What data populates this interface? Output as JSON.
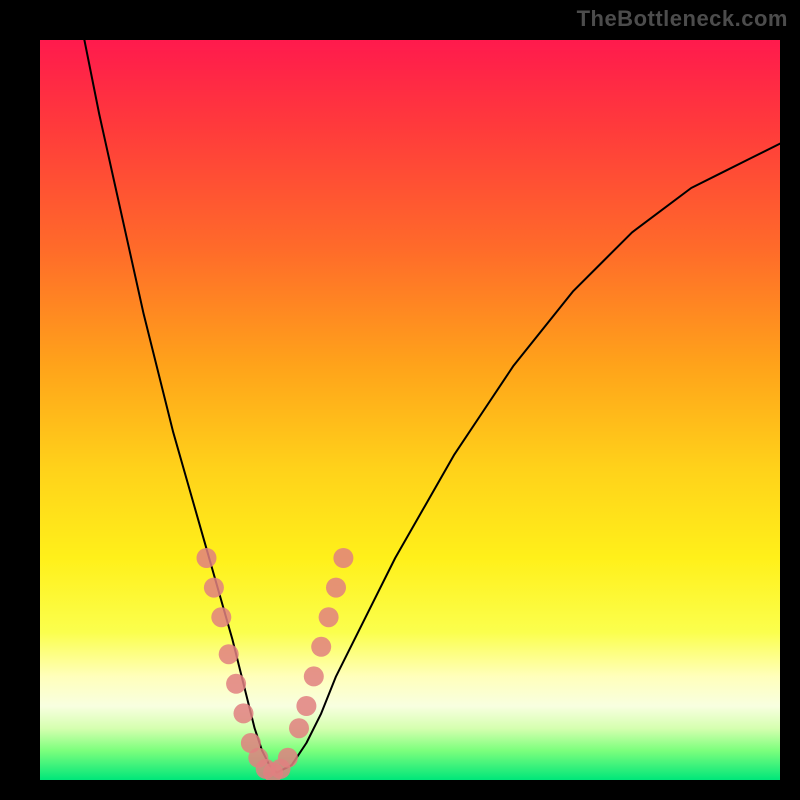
{
  "watermark": "TheBottleneck.com",
  "chart_data": {
    "type": "line",
    "title": "",
    "xlabel": "",
    "ylabel": "",
    "xlim": [
      0,
      100
    ],
    "ylim": [
      0,
      100
    ],
    "series": [
      {
        "name": "bottleneck-curve",
        "x": [
          6,
          8,
          10,
          12,
          14,
          16,
          18,
          20,
          22,
          24,
          26,
          27,
          28,
          29,
          30,
          31,
          32,
          34,
          36,
          38,
          40,
          44,
          48,
          52,
          56,
          60,
          64,
          68,
          72,
          76,
          80,
          84,
          88,
          92,
          96,
          100
        ],
        "y": [
          100,
          90,
          81,
          72,
          63,
          55,
          47,
          40,
          33,
          26,
          19,
          15,
          11,
          7,
          4,
          2,
          1,
          2,
          5,
          9,
          14,
          22,
          30,
          37,
          44,
          50,
          56,
          61,
          66,
          70,
          74,
          77,
          80,
          82,
          84,
          86
        ]
      }
    ],
    "markers": {
      "name": "highlight-beads",
      "points": [
        {
          "x": 22.5,
          "y": 30
        },
        {
          "x": 23.5,
          "y": 26
        },
        {
          "x": 24.5,
          "y": 22
        },
        {
          "x": 25.5,
          "y": 17
        },
        {
          "x": 26.5,
          "y": 13
        },
        {
          "x": 27.5,
          "y": 9
        },
        {
          "x": 28.5,
          "y": 5
        },
        {
          "x": 29.5,
          "y": 3
        },
        {
          "x": 30.5,
          "y": 1.5
        },
        {
          "x": 31.5,
          "y": 1
        },
        {
          "x": 32.5,
          "y": 1.5
        },
        {
          "x": 33.5,
          "y": 3
        },
        {
          "x": 35,
          "y": 7
        },
        {
          "x": 36,
          "y": 10
        },
        {
          "x": 37,
          "y": 14
        },
        {
          "x": 38,
          "y": 18
        },
        {
          "x": 39,
          "y": 22
        },
        {
          "x": 40,
          "y": 26
        },
        {
          "x": 41,
          "y": 30
        }
      ],
      "color": "#e08080",
      "radius": 10
    },
    "curve_color": "#000000",
    "curve_width": 2
  }
}
